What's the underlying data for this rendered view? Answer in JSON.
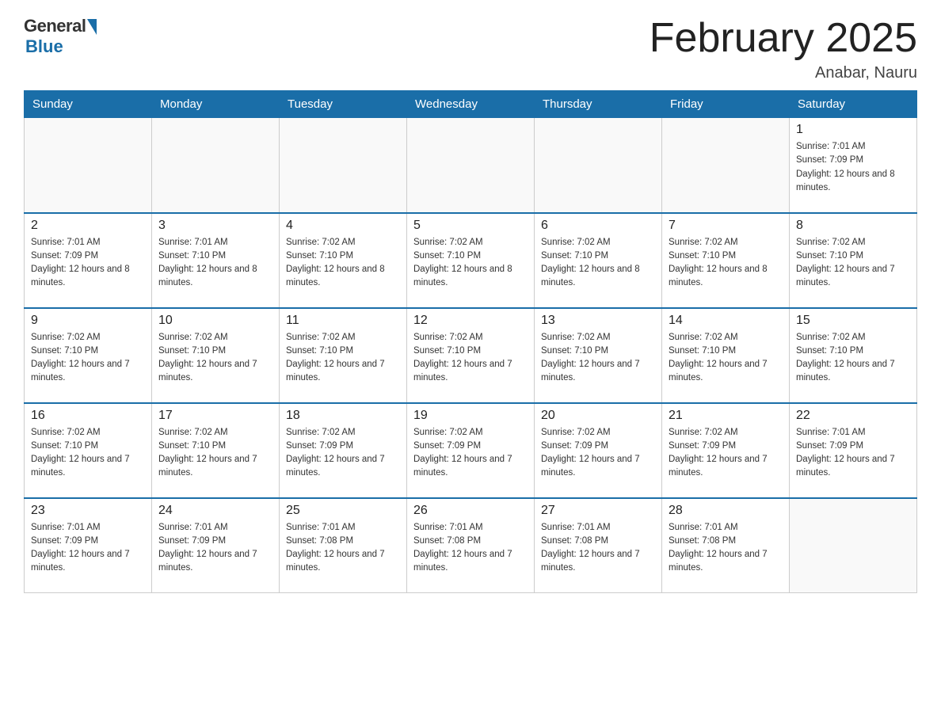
{
  "logo": {
    "general": "General",
    "blue": "Blue"
  },
  "title": "February 2025",
  "subtitle": "Anabar, Nauru",
  "days_header": [
    "Sunday",
    "Monday",
    "Tuesday",
    "Wednesday",
    "Thursday",
    "Friday",
    "Saturday"
  ],
  "weeks": [
    [
      {
        "day": "",
        "sunrise": "",
        "sunset": "",
        "daylight": ""
      },
      {
        "day": "",
        "sunrise": "",
        "sunset": "",
        "daylight": ""
      },
      {
        "day": "",
        "sunrise": "",
        "sunset": "",
        "daylight": ""
      },
      {
        "day": "",
        "sunrise": "",
        "sunset": "",
        "daylight": ""
      },
      {
        "day": "",
        "sunrise": "",
        "sunset": "",
        "daylight": ""
      },
      {
        "day": "",
        "sunrise": "",
        "sunset": "",
        "daylight": ""
      },
      {
        "day": "1",
        "sunrise": "Sunrise: 7:01 AM",
        "sunset": "Sunset: 7:09 PM",
        "daylight": "Daylight: 12 hours and 8 minutes."
      }
    ],
    [
      {
        "day": "2",
        "sunrise": "Sunrise: 7:01 AM",
        "sunset": "Sunset: 7:09 PM",
        "daylight": "Daylight: 12 hours and 8 minutes."
      },
      {
        "day": "3",
        "sunrise": "Sunrise: 7:01 AM",
        "sunset": "Sunset: 7:10 PM",
        "daylight": "Daylight: 12 hours and 8 minutes."
      },
      {
        "day": "4",
        "sunrise": "Sunrise: 7:02 AM",
        "sunset": "Sunset: 7:10 PM",
        "daylight": "Daylight: 12 hours and 8 minutes."
      },
      {
        "day": "5",
        "sunrise": "Sunrise: 7:02 AM",
        "sunset": "Sunset: 7:10 PM",
        "daylight": "Daylight: 12 hours and 8 minutes."
      },
      {
        "day": "6",
        "sunrise": "Sunrise: 7:02 AM",
        "sunset": "Sunset: 7:10 PM",
        "daylight": "Daylight: 12 hours and 8 minutes."
      },
      {
        "day": "7",
        "sunrise": "Sunrise: 7:02 AM",
        "sunset": "Sunset: 7:10 PM",
        "daylight": "Daylight: 12 hours and 8 minutes."
      },
      {
        "day": "8",
        "sunrise": "Sunrise: 7:02 AM",
        "sunset": "Sunset: 7:10 PM",
        "daylight": "Daylight: 12 hours and 7 minutes."
      }
    ],
    [
      {
        "day": "9",
        "sunrise": "Sunrise: 7:02 AM",
        "sunset": "Sunset: 7:10 PM",
        "daylight": "Daylight: 12 hours and 7 minutes."
      },
      {
        "day": "10",
        "sunrise": "Sunrise: 7:02 AM",
        "sunset": "Sunset: 7:10 PM",
        "daylight": "Daylight: 12 hours and 7 minutes."
      },
      {
        "day": "11",
        "sunrise": "Sunrise: 7:02 AM",
        "sunset": "Sunset: 7:10 PM",
        "daylight": "Daylight: 12 hours and 7 minutes."
      },
      {
        "day": "12",
        "sunrise": "Sunrise: 7:02 AM",
        "sunset": "Sunset: 7:10 PM",
        "daylight": "Daylight: 12 hours and 7 minutes."
      },
      {
        "day": "13",
        "sunrise": "Sunrise: 7:02 AM",
        "sunset": "Sunset: 7:10 PM",
        "daylight": "Daylight: 12 hours and 7 minutes."
      },
      {
        "day": "14",
        "sunrise": "Sunrise: 7:02 AM",
        "sunset": "Sunset: 7:10 PM",
        "daylight": "Daylight: 12 hours and 7 minutes."
      },
      {
        "day": "15",
        "sunrise": "Sunrise: 7:02 AM",
        "sunset": "Sunset: 7:10 PM",
        "daylight": "Daylight: 12 hours and 7 minutes."
      }
    ],
    [
      {
        "day": "16",
        "sunrise": "Sunrise: 7:02 AM",
        "sunset": "Sunset: 7:10 PM",
        "daylight": "Daylight: 12 hours and 7 minutes."
      },
      {
        "day": "17",
        "sunrise": "Sunrise: 7:02 AM",
        "sunset": "Sunset: 7:10 PM",
        "daylight": "Daylight: 12 hours and 7 minutes."
      },
      {
        "day": "18",
        "sunrise": "Sunrise: 7:02 AM",
        "sunset": "Sunset: 7:09 PM",
        "daylight": "Daylight: 12 hours and 7 minutes."
      },
      {
        "day": "19",
        "sunrise": "Sunrise: 7:02 AM",
        "sunset": "Sunset: 7:09 PM",
        "daylight": "Daylight: 12 hours and 7 minutes."
      },
      {
        "day": "20",
        "sunrise": "Sunrise: 7:02 AM",
        "sunset": "Sunset: 7:09 PM",
        "daylight": "Daylight: 12 hours and 7 minutes."
      },
      {
        "day": "21",
        "sunrise": "Sunrise: 7:02 AM",
        "sunset": "Sunset: 7:09 PM",
        "daylight": "Daylight: 12 hours and 7 minutes."
      },
      {
        "day": "22",
        "sunrise": "Sunrise: 7:01 AM",
        "sunset": "Sunset: 7:09 PM",
        "daylight": "Daylight: 12 hours and 7 minutes."
      }
    ],
    [
      {
        "day": "23",
        "sunrise": "Sunrise: 7:01 AM",
        "sunset": "Sunset: 7:09 PM",
        "daylight": "Daylight: 12 hours and 7 minutes."
      },
      {
        "day": "24",
        "sunrise": "Sunrise: 7:01 AM",
        "sunset": "Sunset: 7:09 PM",
        "daylight": "Daylight: 12 hours and 7 minutes."
      },
      {
        "day": "25",
        "sunrise": "Sunrise: 7:01 AM",
        "sunset": "Sunset: 7:08 PM",
        "daylight": "Daylight: 12 hours and 7 minutes."
      },
      {
        "day": "26",
        "sunrise": "Sunrise: 7:01 AM",
        "sunset": "Sunset: 7:08 PM",
        "daylight": "Daylight: 12 hours and 7 minutes."
      },
      {
        "day": "27",
        "sunrise": "Sunrise: 7:01 AM",
        "sunset": "Sunset: 7:08 PM",
        "daylight": "Daylight: 12 hours and 7 minutes."
      },
      {
        "day": "28",
        "sunrise": "Sunrise: 7:01 AM",
        "sunset": "Sunset: 7:08 PM",
        "daylight": "Daylight: 12 hours and 7 minutes."
      },
      {
        "day": "",
        "sunrise": "",
        "sunset": "",
        "daylight": ""
      }
    ]
  ]
}
